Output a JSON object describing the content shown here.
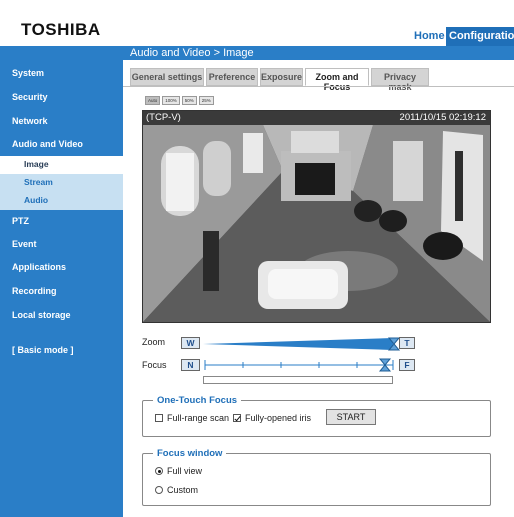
{
  "header": {
    "logo": "TOSHIBA",
    "home": "Home",
    "configuration": "Configuration"
  },
  "breadcrumb": "Audio and Video  > Image",
  "sidebar": {
    "items": [
      {
        "label": "System"
      },
      {
        "label": "Security"
      },
      {
        "label": "Network"
      },
      {
        "label": "Audio and Video"
      },
      {
        "label": "Image"
      },
      {
        "label": "Stream"
      },
      {
        "label": "Audio"
      },
      {
        "label": "PTZ"
      },
      {
        "label": "Event"
      },
      {
        "label": "Applications"
      },
      {
        "label": "Recording"
      },
      {
        "label": "Local storage"
      },
      {
        "label": "[ Basic mode ]"
      }
    ]
  },
  "tabs": [
    {
      "label": "General settings"
    },
    {
      "label": "Preference"
    },
    {
      "label": "Exposure"
    },
    {
      "label": "Zoom and Focus",
      "active": true
    },
    {
      "label": "Privacy mask"
    }
  ],
  "resolution_buttons": [
    "Auto",
    "100%",
    "50%",
    "25%"
  ],
  "video": {
    "name": "(TCP-V)",
    "timestamp": "2011/10/15 02:19:12"
  },
  "zoom": {
    "label": "Zoom",
    "wide": "W",
    "tele": "T",
    "level": 1.0
  },
  "focus": {
    "label": "Focus",
    "near": "N",
    "far": "F",
    "level": 0.97
  },
  "one_touch_focus": {
    "title": "One-Touch Focus",
    "full_range_scan": {
      "label": "Full-range scan",
      "checked": false
    },
    "fully_opened_iris": {
      "label": "Fully-opened iris",
      "checked": true
    },
    "start": "START"
  },
  "focus_window": {
    "title": "Focus window",
    "options": [
      {
        "label": "Full view",
        "selected": true
      },
      {
        "label": "Custom",
        "selected": false
      }
    ]
  },
  "colors": {
    "accent": "#2a7ec7",
    "sub_bg": "#c7e0f2",
    "link": "#1f6fb8"
  }
}
